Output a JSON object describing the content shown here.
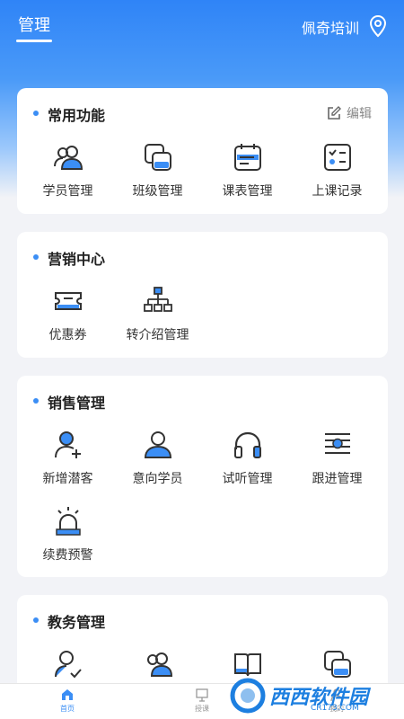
{
  "header": {
    "tab_label": "管理",
    "org_name": "佩奇培训"
  },
  "sections": [
    {
      "title": "常用功能",
      "edit_label": "编辑",
      "items": [
        {
          "label": "学员管理",
          "icon": "students-icon"
        },
        {
          "label": "班级管理",
          "icon": "class-icon"
        },
        {
          "label": "课表管理",
          "icon": "schedule-icon"
        },
        {
          "label": "上课记录",
          "icon": "records-icon"
        }
      ]
    },
    {
      "title": "营销中心",
      "items": [
        {
          "label": "优惠券",
          "icon": "coupon-icon"
        },
        {
          "label": "转介绍管理",
          "icon": "referral-icon"
        }
      ]
    },
    {
      "title": "销售管理",
      "items": [
        {
          "label": "新增潜客",
          "icon": "add-lead-icon"
        },
        {
          "label": "意向学员",
          "icon": "prospect-icon"
        },
        {
          "label": "试听管理",
          "icon": "headphones-icon"
        },
        {
          "label": "跟进管理",
          "icon": "followup-icon"
        },
        {
          "label": "续费预警",
          "icon": "alarm-icon"
        }
      ]
    },
    {
      "title": "教务管理",
      "items": []
    }
  ],
  "bottom_nav": [
    {
      "label": "首页",
      "icon": "home-icon",
      "active": true
    },
    {
      "label": "授课",
      "icon": "teach-icon",
      "active": false
    },
    {
      "label": "我的",
      "icon": "profile-icon",
      "active": false
    }
  ],
  "watermark": {
    "text": "西西软件园",
    "sub": "CR173.COM"
  },
  "colors": {
    "accent": "#3b8ef5",
    "header_gradient_top": "#2f84f7",
    "text": "#333333"
  }
}
